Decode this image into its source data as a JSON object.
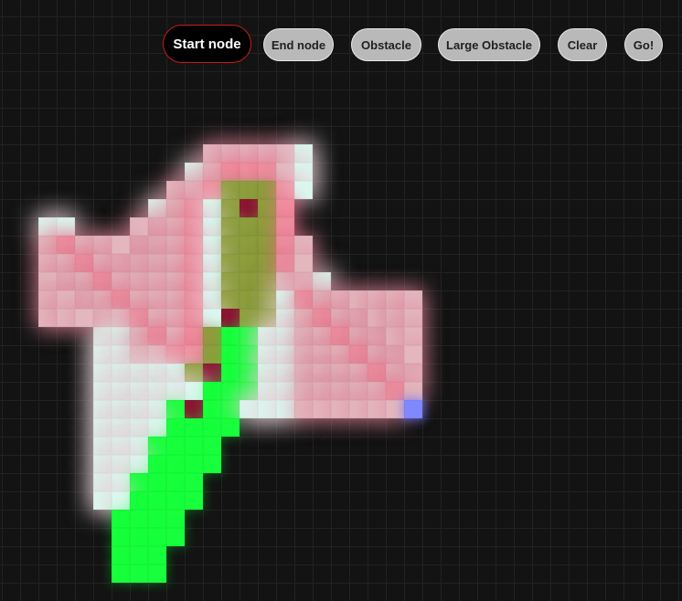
{
  "toolbar": {
    "buttons": [
      {
        "id": "start",
        "label": "Start node",
        "active": true
      },
      {
        "id": "end",
        "label": "End node",
        "active": false
      },
      {
        "id": "obstacle",
        "label": "Obstacle",
        "active": false
      },
      {
        "id": "large-obstacle",
        "label": "Large Obstacle",
        "active": false
      },
      {
        "id": "clear",
        "label": "Clear",
        "active": false
      },
      {
        "id": "go",
        "label": "Go!",
        "active": false
      }
    ]
  },
  "grid": {
    "cell_states": {
      "visited": "#dcf7f0",
      "frontier": "#e3b7bd",
      "path": "#ef8f9f",
      "search": "#8f9e3c",
      "green": "#18ff3d",
      "obstacle": "#8b1533",
      "end": "#7f88ff"
    },
    "colors": {
      "background": "#131313",
      "grid_line": "#222222",
      "active_button_border": "#c81b1b",
      "button_fill": "#b9b9b9"
    }
  }
}
